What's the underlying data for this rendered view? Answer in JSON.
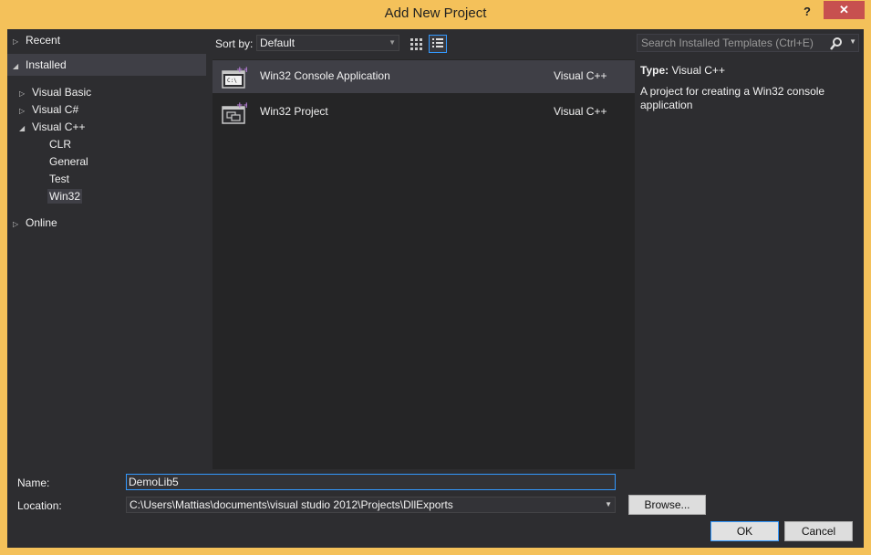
{
  "window": {
    "title": "Add New Project",
    "help_label": "?",
    "close_label": "✕"
  },
  "tree": {
    "recent": "Recent",
    "installed": "Installed",
    "items": [
      "Visual Basic",
      "Visual C#",
      "Visual C++"
    ],
    "cpp_children": [
      "CLR",
      "General",
      "Test",
      "Win32"
    ],
    "online": "Online"
  },
  "toolbar": {
    "sort_label": "Sort by:",
    "sort_value": "Default"
  },
  "templates": [
    {
      "name": "Win32 Console Application",
      "language": "Visual C++",
      "selected": true,
      "icon": "console-app-icon"
    },
    {
      "name": "Win32 Project",
      "language": "Visual C++",
      "selected": false,
      "icon": "win32-project-icon"
    }
  ],
  "search": {
    "placeholder": "Search Installed Templates (Ctrl+E)"
  },
  "details": {
    "type_label": "Type:",
    "type_value": "Visual C++",
    "description": "A project for creating a Win32 console application"
  },
  "form": {
    "name_label": "Name:",
    "name_value": "DemoLib5",
    "location_label": "Location:",
    "location_value": "C:\\Users\\Mattias\\documents\\visual studio 2012\\Projects\\DllExports",
    "browse_label": "Browse...",
    "ok_label": "OK",
    "cancel_label": "Cancel"
  },
  "colors": {
    "frame": "#f4c15a",
    "background": "#2d2d30",
    "list_background": "#252526",
    "selection": "#3f3f46",
    "accent": "#3399ff",
    "close_button": "#c7504f"
  }
}
